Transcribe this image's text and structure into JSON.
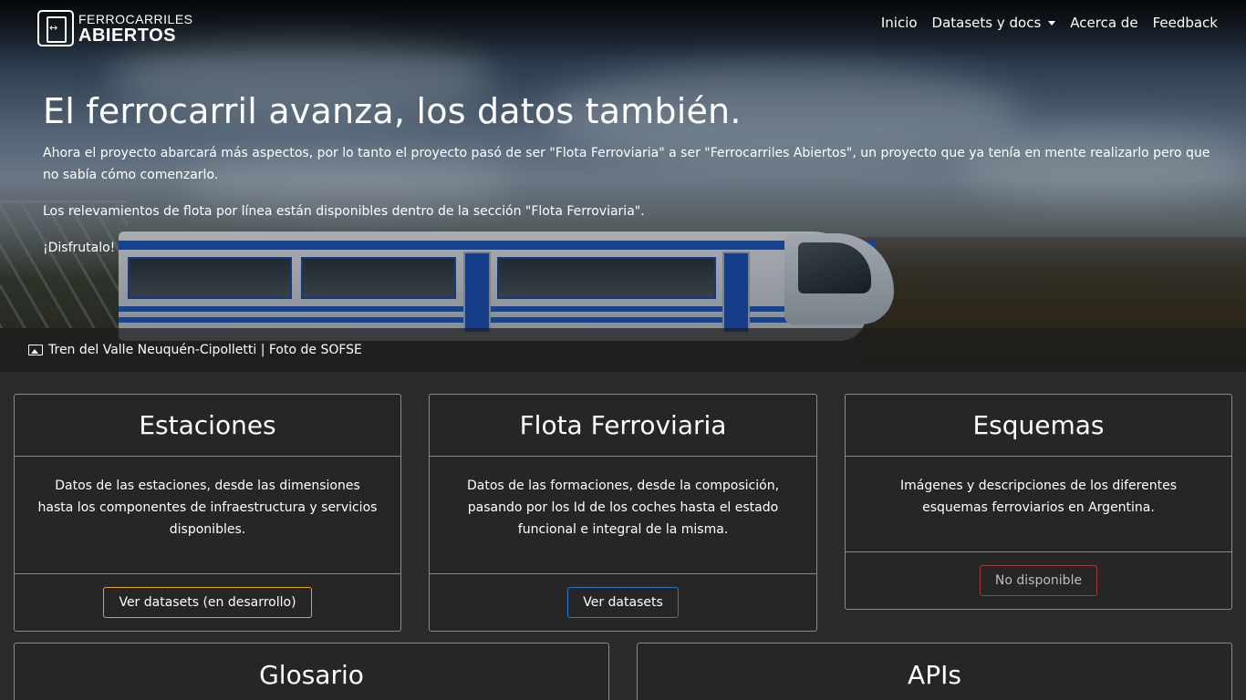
{
  "brand": {
    "line1": "FERROCARRILES",
    "line2": "ABIERTOS"
  },
  "nav": {
    "items": [
      {
        "label": "Inicio"
      },
      {
        "label": "Datasets y docs"
      },
      {
        "label": "Acerca de"
      },
      {
        "label": "Feedback"
      }
    ]
  },
  "hero": {
    "title": "El ferrocarril avanza, los datos también.",
    "paragraphs": [
      "Ahora el proyecto abarcará más aspectos, por lo tanto el proyecto pasó de ser \"Flota Ferroviaria\" a ser \"Ferrocarriles Abiertos\", un proyecto que ya tenía en mente realizarlo pero que no sabía cómo comenzarlo.",
      "Los relevamientos de flota por línea están disponibles dentro de la sección \"Flota Ferroviaria\".",
      "¡Disfrutalo!"
    ],
    "caption": "Tren del Valle Neuquén-Cipolletti | Foto de SOFSE"
  },
  "cards": [
    {
      "title": "Estaciones",
      "text": "Datos de las estaciones, desde las dimensiones hasta los componentes de infraestructura y servicios disponibles.",
      "button": "Ver datasets (en desarrollo)"
    },
    {
      "title": "Flota Ferroviaria",
      "text": "Datos de las formaciones, desde la composición, pasando por los Id de los coches hasta el estado funcional e integral de la misma.",
      "button": "Ver datasets"
    },
    {
      "title": "Esquemas",
      "text": "Imágenes y descripciones de los diferentes esquemas ferroviarios en Argentina.",
      "button": "No disponible"
    },
    {
      "title": "Glosario"
    },
    {
      "title": "APIs"
    }
  ]
}
